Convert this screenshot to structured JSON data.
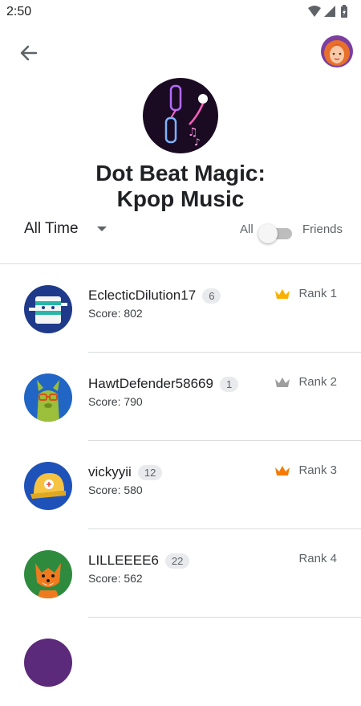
{
  "status": {
    "time": "2:50"
  },
  "game": {
    "title_line1": "Dot Beat Magic:",
    "title_line2": "Kpop Music"
  },
  "filter": {
    "time_range": "All Time",
    "toggle_left": "All",
    "toggle_right": "Friends",
    "friends_only": false
  },
  "leaderboard": [
    {
      "name": "EclecticDilution17",
      "level": "6",
      "score": "Score: 802",
      "rank": "Rank 1",
      "crown": "gold-crown",
      "crown_color": "#f9b000"
    },
    {
      "name": "HawtDefender58669",
      "level": "1",
      "score": "Score: 790",
      "rank": "Rank 2",
      "crown": "silver-crown",
      "crown_color": "#9e9e9e"
    },
    {
      "name": "vickyyii",
      "level": "12",
      "score": "Score: 580",
      "rank": "Rank 3",
      "crown": "bronze-crown",
      "crown_color": "#f57c00"
    },
    {
      "name": "LILLEEEE6",
      "level": "22",
      "score": "Score: 562",
      "rank": "Rank 4",
      "crown": "",
      "crown_color": ""
    }
  ]
}
